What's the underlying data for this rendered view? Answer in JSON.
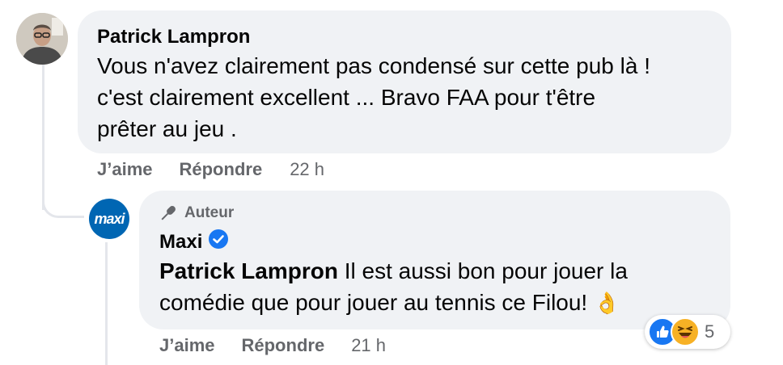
{
  "comment": {
    "author": "Patrick Lampron",
    "text_lines": [
      "Vous n'avez clairement pas condensé sur cette pub là !",
      "c'est clairement excellent ... Bravo FAA pour t'être",
      "prêter au jeu ."
    ],
    "like_label": "J’aime",
    "reply_label": "Répondre",
    "time": "22 h"
  },
  "reply": {
    "badge_label": "Auteur",
    "author": "Maxi",
    "avatar_text": "maxi",
    "mention": "Patrick Lampron",
    "text_line1_rest": " Il est aussi bon pour jouer la",
    "text_line2": "comédie que pour jouer au tennis ce Filou! ",
    "emoji": "👌",
    "like_label": "J’aime",
    "reply_label": "Répondre",
    "time": "21 h",
    "reaction_count": "5",
    "reaction_icons": [
      "like-icon",
      "laughing-emoji-icon"
    ]
  },
  "colors": {
    "bubble": "#f0f2f5",
    "secondary_text": "#65676b",
    "verified_blue": "#1877f2",
    "maxi_blue": "#0066b3",
    "thread_line": "#e4e6eb"
  }
}
